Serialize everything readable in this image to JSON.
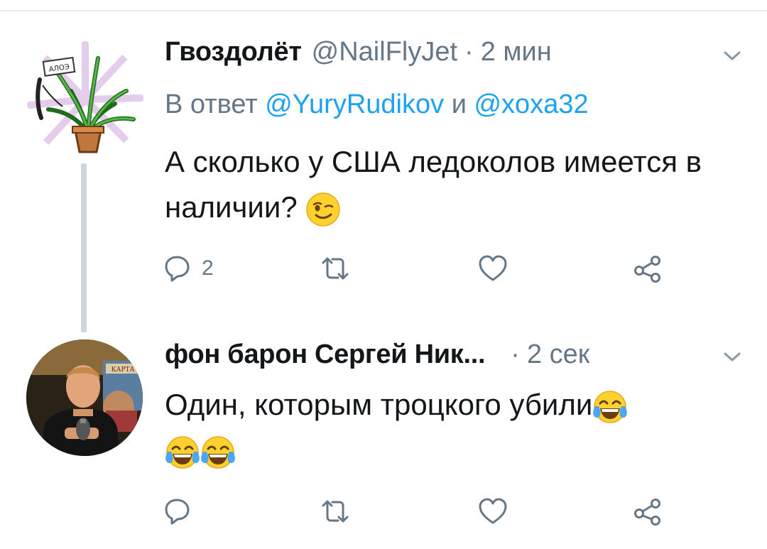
{
  "tweets": [
    {
      "display_name": "Гвоздолёт",
      "handle": "@NailFlyJet",
      "separator": "·",
      "time": "2 мин",
      "reply_to": {
        "prefix": "В ответ",
        "mention1": "@YuryRudikov",
        "conjunction": "и",
        "mention2": "@xoxa32"
      },
      "text": "А сколько у США ледоколов имеется в наличии?",
      "emoji": [
        "winking-face"
      ],
      "actions": {
        "reply_count": "2"
      },
      "avatar_sign": "АЛОЭ"
    },
    {
      "display_name": "фон барон Сергей Ник...",
      "separator": "·",
      "time": "2 сек",
      "text": "Один, которым троцкого убили",
      "emoji": [
        "face-with-tears-of-joy",
        "face-with-tears-of-joy",
        "face-with-tears-of-joy"
      ],
      "actions": {
        "reply_count": ""
      },
      "avatar_sign": "КАРТА"
    }
  ],
  "colors": {
    "text": "#14171a",
    "secondary": "#657786",
    "link": "#1da1f2",
    "thread_line": "#ccd6dd",
    "icon": "#657786"
  }
}
